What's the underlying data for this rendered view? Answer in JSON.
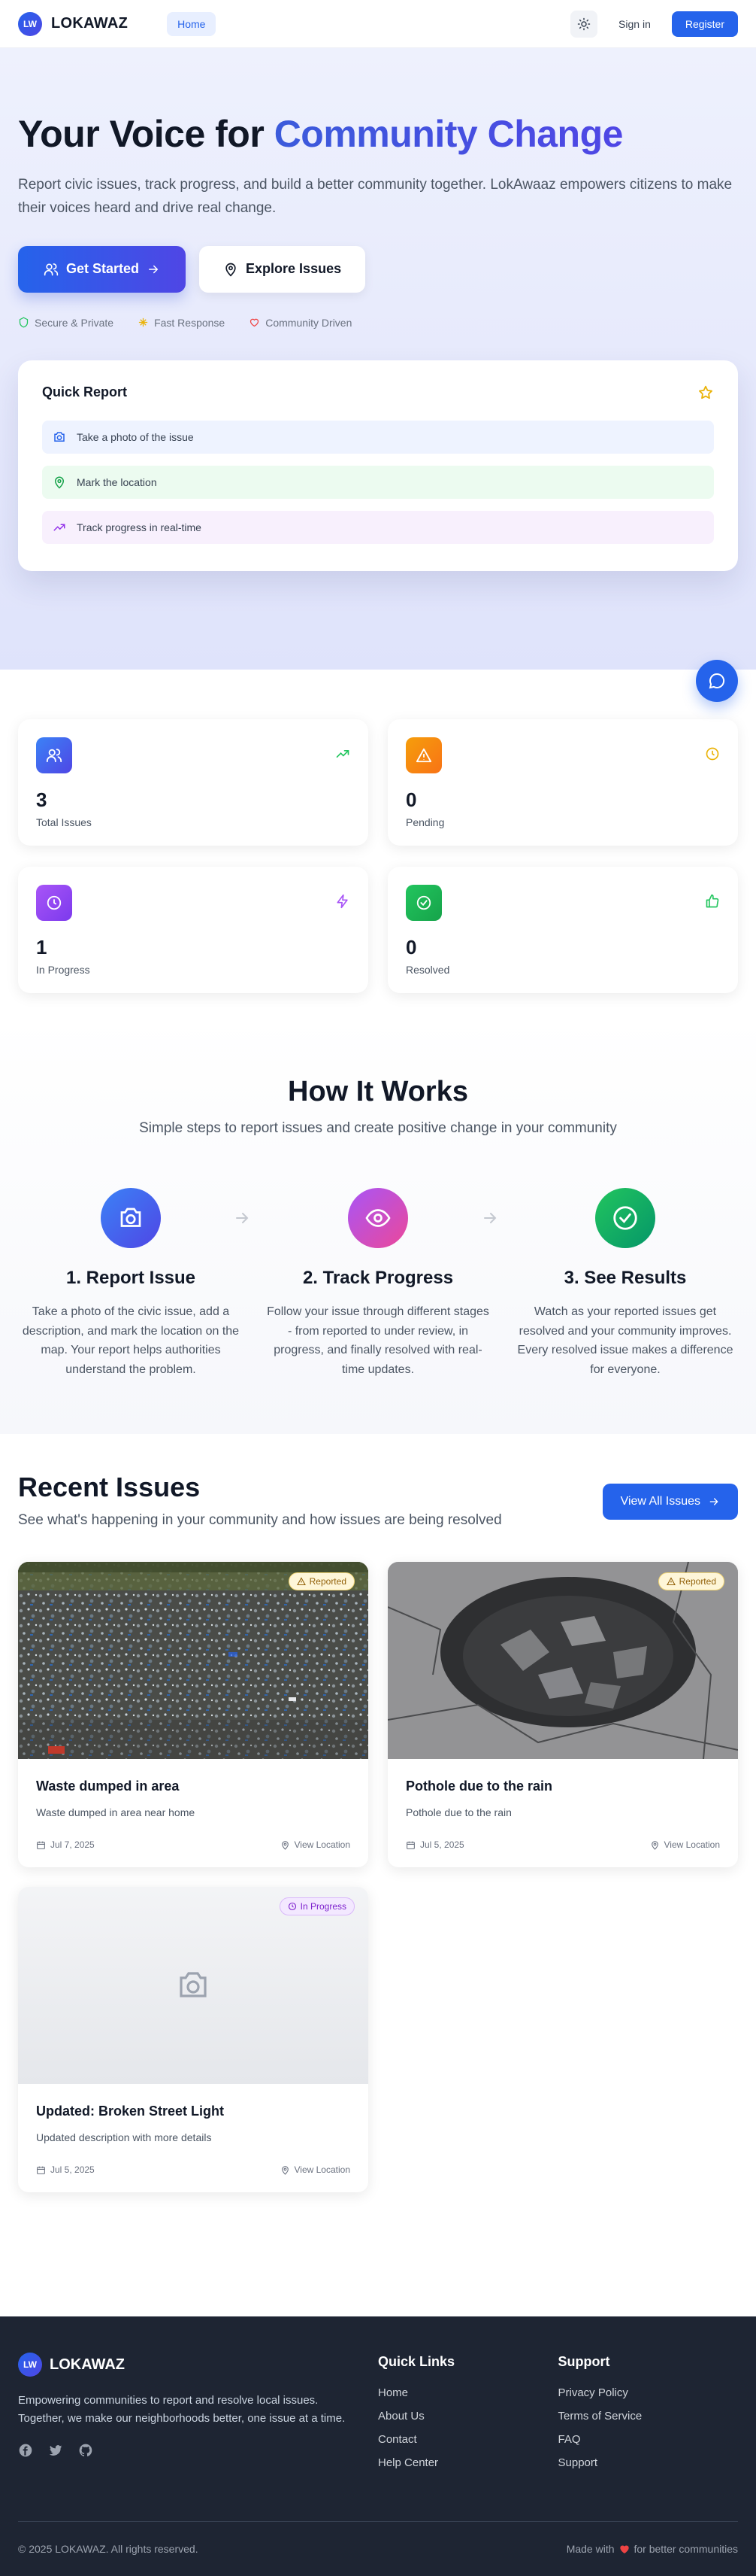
{
  "nav": {
    "logo_badge": "LW",
    "logo_text": "LOKAWAZ",
    "home": "Home",
    "sign_in": "Sign in",
    "register": "Register"
  },
  "hero": {
    "title_plain": "Your Voice for ",
    "title_accent": "Community Change",
    "description": "Report civic issues, track progress, and build a better community together. LokAwaaz empowers citizens to make their voices heard and drive real change.",
    "primary_button": "Get Started",
    "secondary_button": "Explore Issues",
    "trust": [
      "Secure & Private",
      "Fast Response",
      "Community Driven"
    ]
  },
  "quick_report": {
    "title": "Quick Report",
    "items": [
      "Take a photo of the issue",
      "Mark the location",
      "Track progress in real-time"
    ]
  },
  "stats": [
    {
      "value": "3",
      "label": "Total Issues"
    },
    {
      "value": "0",
      "label": "Pending"
    },
    {
      "value": "1",
      "label": "In Progress"
    },
    {
      "value": "0",
      "label": "Resolved"
    }
  ],
  "how": {
    "title": "How It Works",
    "subtitle": "Simple steps to report issues and create positive change in your community",
    "steps": [
      {
        "title": "1. Report Issue",
        "text": "Take a photo of the civic issue, add a description, and mark the location on the map. Your report helps authorities understand the problem."
      },
      {
        "title": "2. Track Progress",
        "text": "Follow your issue through different stages - from reported to under review, in progress, and finally resolved with real-time updates."
      },
      {
        "title": "3. See Results",
        "text": "Watch as your reported issues get resolved and your community improves. Every resolved issue makes a difference for everyone."
      }
    ]
  },
  "recent": {
    "title": "Recent Issues",
    "subtitle": "See what's happening in your community and how issues are being resolved",
    "view_all": "View All Issues",
    "location_label": "View Location",
    "issues": [
      {
        "title": "Waste dumped in area",
        "description": "Waste dumped in area near home",
        "date": "Jul 7, 2025",
        "status": "Reported"
      },
      {
        "title": "Pothole due to the rain",
        "description": "Pothole due to the rain",
        "date": "Jul 5, 2025",
        "status": "Reported"
      },
      {
        "title": "Updated: Broken Street Light",
        "description": "Updated description with more details",
        "date": "Jul 5, 2025",
        "status": "In Progress"
      }
    ]
  },
  "footer": {
    "logo_badge": "LW",
    "brand": "LOKAWAZ",
    "about": "Empowering communities to report and resolve local issues. Together, we make our neighborhoods better, one issue at a time.",
    "quick_links_title": "Quick Links",
    "quick_links": [
      "Home",
      "About Us",
      "Contact",
      "Help Center"
    ],
    "support_title": "Support",
    "support_links": [
      "Privacy Policy",
      "Terms of Service",
      "FAQ",
      "Support"
    ],
    "copyright": "© 2025 LOKAWAZ. All rights reserved.",
    "made_with_prefix": "Made with",
    "made_with_suffix": "for better communities"
  },
  "colors": {
    "primary": "#2563eb",
    "accent": "#4f46e5",
    "footer_bg": "#1e2533"
  }
}
